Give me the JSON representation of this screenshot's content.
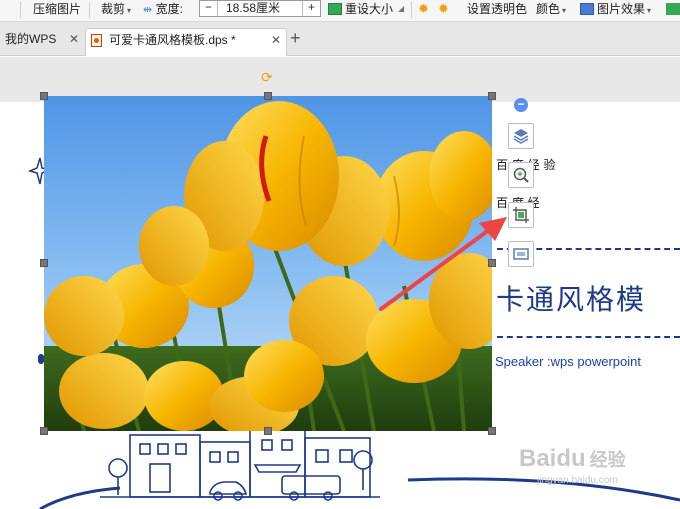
{
  "toolbar": {
    "compress_label": "压缩图片",
    "crop_label": "裁剪",
    "width_label": "宽度:",
    "width_value": "18.58厘米",
    "width_minus": "−",
    "width_plus": "+",
    "reset_size_label": "重设大小",
    "transparent_label": "设置透明色",
    "color_label": "颜色",
    "effects_label": "图片效果"
  },
  "tabs": [
    {
      "label": "我的WPS",
      "close": "✕"
    },
    {
      "label": "可爱卡通风格模板.dps *",
      "close": "✕"
    }
  ],
  "new_tab_label": "+",
  "slide": {
    "text1": "百 度 经 验",
    "text2": "百 度 经",
    "title_fragment": "卡通风格模",
    "speaker": "Speaker :wps powerpoint"
  },
  "side_tools": [
    {
      "icon": "layers-icon"
    },
    {
      "icon": "zoom-in-icon"
    },
    {
      "icon": "crop-image-icon"
    },
    {
      "icon": "frame-icon"
    }
  ],
  "watermark": {
    "brand": "Baidu",
    "suffix": "经验",
    "url": "jingyan.baidu.com"
  },
  "colors": {
    "accent_blue": "#1e3a8a",
    "arrow_red": "#ef4444",
    "handle_gray": "#777777",
    "rotate_orange": "#f59e0b"
  }
}
